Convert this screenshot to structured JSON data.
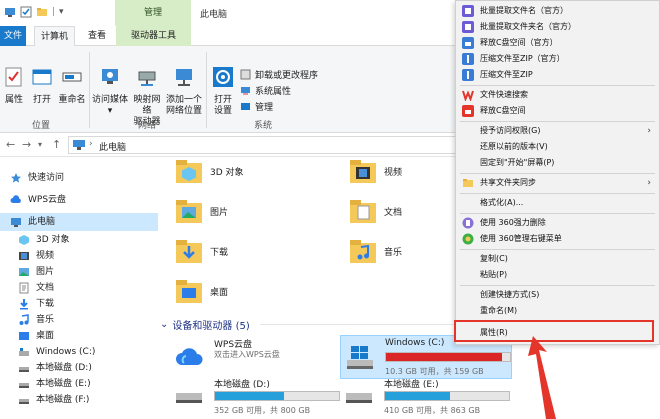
{
  "window": {
    "title": "此电脑",
    "tools_header": "管理"
  },
  "ribbon_tabs": {
    "file": "文件",
    "computer": "计算机",
    "view": "查看",
    "drive_tools": "驱动器工具"
  },
  "ribbon": {
    "location_group": {
      "label": "位置",
      "properties": "属性",
      "open": "打开",
      "rename": "重命名"
    },
    "network_group": {
      "label": "网络",
      "access_media": "访问媒体",
      "map_drive_1": "映射网络",
      "map_drive_2": "驱动器",
      "add_location_1": "添加一个",
      "add_location_2": "网络位置"
    },
    "system_group": {
      "label": "系统",
      "open_settings_1": "打开",
      "open_settings_2": "设置",
      "uninstall": "卸载或更改程序",
      "system_props": "系统属性",
      "manage": "管理"
    }
  },
  "address": {
    "path": "此电脑"
  },
  "nav": {
    "items": [
      {
        "label": "快速访问",
        "icon": "star-icon"
      },
      {
        "label": "WPS云盘",
        "icon": "cloud-icon"
      },
      {
        "label": "此电脑",
        "icon": "computer-icon"
      },
      {
        "label": "3D 对象",
        "icon": "3d-objects-icon"
      },
      {
        "label": "视频",
        "icon": "video-icon"
      },
      {
        "label": "图片",
        "icon": "pictures-icon"
      },
      {
        "label": "文档",
        "icon": "documents-icon"
      },
      {
        "label": "下载",
        "icon": "download-icon"
      },
      {
        "label": "音乐",
        "icon": "music-icon"
      },
      {
        "label": "桌面",
        "icon": "desktop-icon"
      },
      {
        "label": "Windows (C:)",
        "icon": "drive-icon"
      },
      {
        "label": "本地磁盘 (D:)",
        "icon": "drive-icon"
      },
      {
        "label": "本地磁盘 (E:)",
        "icon": "drive-icon"
      },
      {
        "label": "本地磁盘 (F:)",
        "icon": "drive-icon"
      }
    ]
  },
  "folders": [
    {
      "label": "3D 对象"
    },
    {
      "label": "视频"
    },
    {
      "label": "图片"
    },
    {
      "label": "文档"
    },
    {
      "label": "下载"
    },
    {
      "label": "音乐"
    },
    {
      "label": "桌面"
    }
  ],
  "devices": {
    "header": "设备和驱动器 (5)",
    "wps": {
      "name": "WPS云盘",
      "sub": "双击进入WPS云盘"
    },
    "c": {
      "name": "Windows (C:)",
      "sub": "10.3 GB 可用，共 159 GB",
      "used": 0.935
    },
    "d": {
      "name": "本地磁盘 (D:)",
      "sub": "352 GB 可用，共 800 GB",
      "used": 0.56
    },
    "e": {
      "name": "本地磁盘 (E:)",
      "sub": "410 GB 可用，共 863 GB",
      "used": 0.525
    }
  },
  "context_menu": {
    "items": [
      "批量提取文件名（官方）",
      "批量提取文件夹名（官方）",
      "释放C盘空间（官方）",
      "压缩文件至ZIP（官方）",
      "压缩文件至ZIP",
      "文件快速搜索",
      "释放C盘空间",
      "授予访问权限(G)",
      "还原以前的版本(V)",
      "固定到\"开始\"屏幕(P)",
      "共享文件夹同步",
      "格式化(A)...",
      "使用 360强力删除",
      "使用 360管理右键菜单",
      "复制(C)",
      "粘贴(P)",
      "创建快捷方式(S)",
      "重命名(M)",
      "属性(R)"
    ]
  },
  "colors": {
    "accent": "#1979ca",
    "selection": "#cce8ff",
    "drive_full": "#da2626",
    "drive_normal": "#26a0da",
    "annotation": "#e3352a"
  }
}
